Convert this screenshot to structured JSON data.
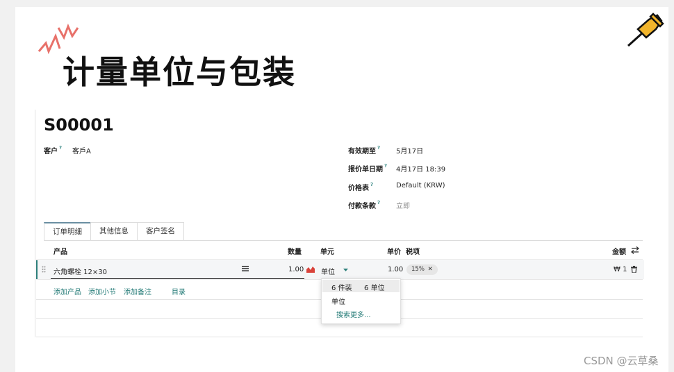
{
  "slide": {
    "title": "计量单位与包装"
  },
  "order": {
    "id": "S00001",
    "customer": {
      "label": "客户",
      "help": "?",
      "value": "客戶A"
    },
    "validity": {
      "label": "有效期至",
      "help": "?",
      "value": "5月17日"
    },
    "quote_date": {
      "label": "报价单日期",
      "help": "?",
      "value": "4月17日 18:39"
    },
    "pricelist": {
      "label": "价格表",
      "help": "?",
      "value": "Default (KRW)"
    },
    "payment_terms": {
      "label": "付款条款",
      "help": "?",
      "placeholder": "立即"
    }
  },
  "tabs": [
    {
      "label": "订单明细",
      "active": true
    },
    {
      "label": "其他信息",
      "active": false
    },
    {
      "label": "客户签名",
      "active": false
    }
  ],
  "table": {
    "headers": {
      "product": "产品",
      "quantity": "数量",
      "unit": "单元",
      "unit_price": "单价",
      "taxes": "税项",
      "amount": "金额"
    },
    "rows": [
      {
        "product": "六角螺栓 12×30",
        "quantity": "1.00",
        "unit": "单位",
        "unit_price": "1.00",
        "tax": "15%",
        "amount": "₩ 1"
      }
    ],
    "add_links": {
      "add_product": "添加产品",
      "add_section": "添加小节",
      "add_note": "添加备注",
      "catalog": "目录"
    }
  },
  "unit_dropdown": {
    "options": [
      {
        "label": "6 件装",
        "sub": "6 单位",
        "highlighted": true
      },
      {
        "label": "单位",
        "sub": "",
        "highlighted": false
      }
    ],
    "search_more": "搜索更多..."
  },
  "watermark": "CSDN @云草桑",
  "colors": {
    "accent": "#2c7f7a",
    "link": "#227a76",
    "badge": "#e6e6e6",
    "forecast_icon": "#d9423a"
  },
  "icons": [
    "burst-icon",
    "pushpin-icon",
    "help-icon",
    "drag-handle-icon",
    "menu-lines-icon",
    "forecast-chart-icon",
    "caret-down-icon",
    "remove-x-icon",
    "trash-icon",
    "column-settings-icon"
  ]
}
